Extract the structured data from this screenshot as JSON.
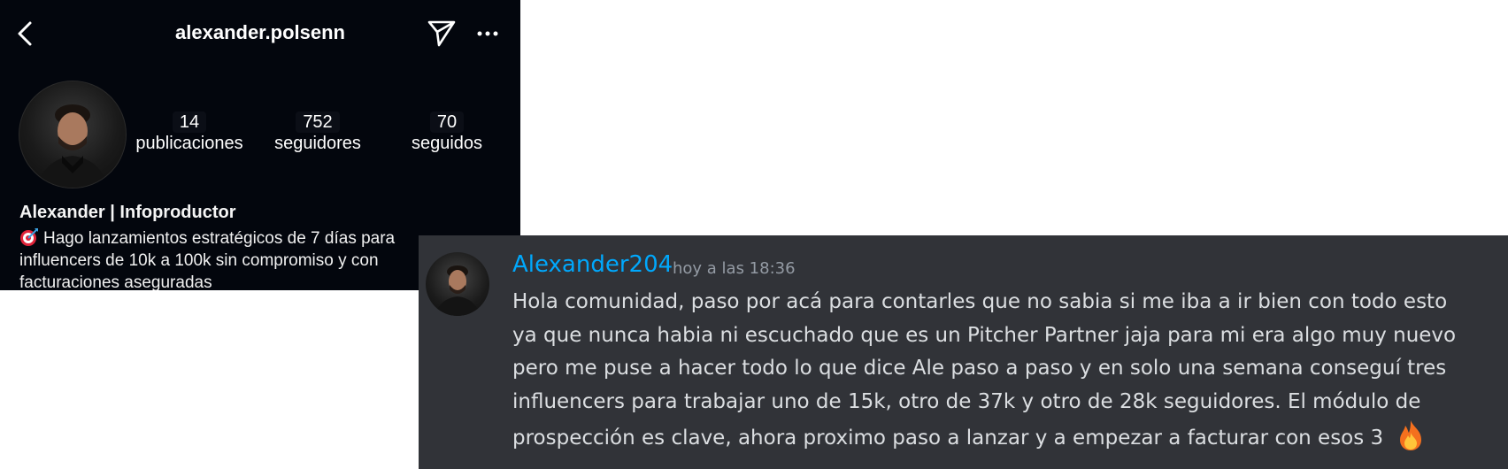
{
  "instagram": {
    "username": "alexander.polsenn",
    "icons": {
      "back": "chevron-left-icon",
      "send": "paper-plane-icon",
      "more": "more-horizontal-icon",
      "bio_emoji": "target-dart-icon"
    },
    "stats": [
      {
        "value": "14",
        "label": "publicaciones"
      },
      {
        "value": "752",
        "label": "seguidores"
      },
      {
        "value": "70",
        "label": "seguidos"
      }
    ],
    "display_name": "Alexander | Infoproductor",
    "bio": "Hago lanzamientos estratégicos de 7 días para influencers de 10k a 100k sin compromiso y con facturaciones aseguradas"
  },
  "discord": {
    "author": "Alexander204",
    "timestamp": "hoy a las 18:36",
    "message": "Hola comunidad, paso por acá para contarles que no sabia si me iba a ir bien con todo esto ya que nunca habia ni escuchado que es un Pitcher Partner jaja para mi era algo muy nuevo pero me puse a hacer todo lo que dice Ale paso a paso y en solo una semana conseguí tres influencers para trabajar uno de 15k, otro de 37k y otro de 28k seguidores. El módulo de prospección es clave, ahora proximo paso a lanzar y a empezar a facturar con esos 3",
    "emoji": "fire-icon",
    "colors": {
      "author": "#00a8fc",
      "background": "#313338",
      "text": "#dbdee1",
      "timestamp": "#949ba4"
    }
  }
}
